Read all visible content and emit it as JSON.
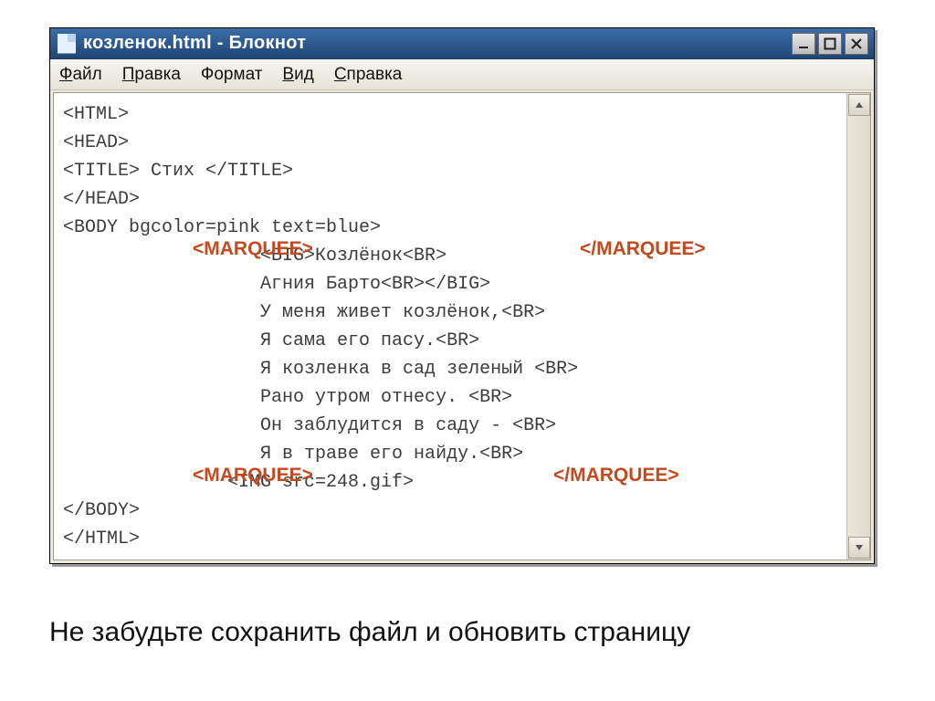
{
  "window": {
    "title": "козленок.html - Блокнот",
    "buttons": {
      "min": "_",
      "max": "□",
      "close": "✕"
    },
    "menubar": [
      {
        "label": "Файл",
        "ul": "Ф",
        "rest": "айл"
      },
      {
        "label": "Правка",
        "ul": "П",
        "rest": "равка"
      },
      {
        "label": "Формат",
        "ul": "",
        "rest": "Формат"
      },
      {
        "label": "Вид",
        "ul": "В",
        "rest": "ид"
      },
      {
        "label": "Справка",
        "ul": "С",
        "rest": "правка"
      }
    ]
  },
  "code": {
    "l1": "<HTML>",
    "l2": "<HEAD>",
    "l3": "<TITLE> Стих </TITLE>",
    "l4": "</HEAD>",
    "l5": "<BODY bgcolor=pink text=blue>",
    "l6": "<BIG>Козлёнок<BR>",
    "l7": "Агния Барто<BR></BIG>",
    "l8": "У меня живет козлёнок,<BR>",
    "l9": "Я сама его пасу.<BR>",
    "l10": "Я козленка в сад зеленый <BR>",
    "l11": "Рано утром отнесу. <BR>",
    "l12": "Он заблудится в саду - <BR>",
    "l13": "Я в траве его найду.<BR>",
    "l14": "<IMG src=248.gif>",
    "l15": "</BODY>",
    "l16": "</HTML>"
  },
  "overlay": {
    "mopen": "<MARQUEE>",
    "mclose": "</MARQUEE>"
  },
  "caption": "Не забудьте сохранить файл и обновить страницу"
}
